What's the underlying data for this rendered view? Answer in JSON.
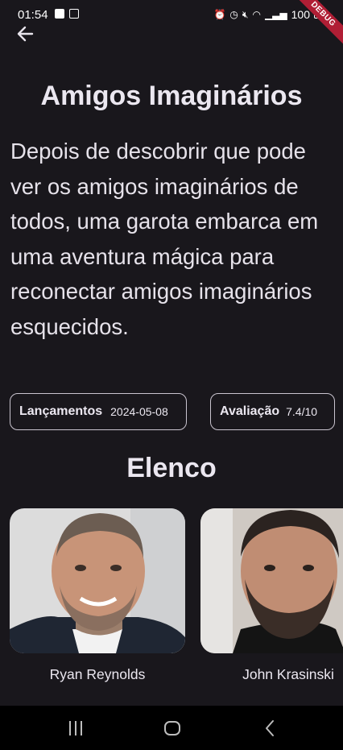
{
  "status_bar": {
    "time": "01:54",
    "battery_text": "100",
    "left_icons": [
      "check-box-icon",
      "lock-icon"
    ],
    "right_icons": [
      "alarm-icon",
      "clock-icon",
      "mute-icon",
      "wifi-icon",
      "signal-icon",
      "battery-icon"
    ]
  },
  "debug_banner": "DEBUG",
  "movie": {
    "title": "Amigos Imaginários",
    "synopsis": "Depois de descobrir que pode ver os amigos imaginários de todos, uma garota embarca em uma aventura mágica para reconectar amigos imaginários esquecidos.",
    "release_label": "Lançamentos",
    "release_date": "2024-05-08",
    "rating_label": "Avaliação",
    "rating_value": "7.4/10"
  },
  "cast_section": {
    "title": "Elenco",
    "members": [
      {
        "name": "Ryan Reynolds"
      },
      {
        "name": "John Krasinski"
      }
    ]
  },
  "navigation": {
    "buttons": [
      "recent-apps-icon",
      "home-icon",
      "back-icon"
    ]
  },
  "colors": {
    "background": "#19171c",
    "text": "#ebe7f0",
    "chip_border": "#c9c4cf",
    "debug_banner": "#b01e35",
    "nav_bar": "#000000"
  }
}
